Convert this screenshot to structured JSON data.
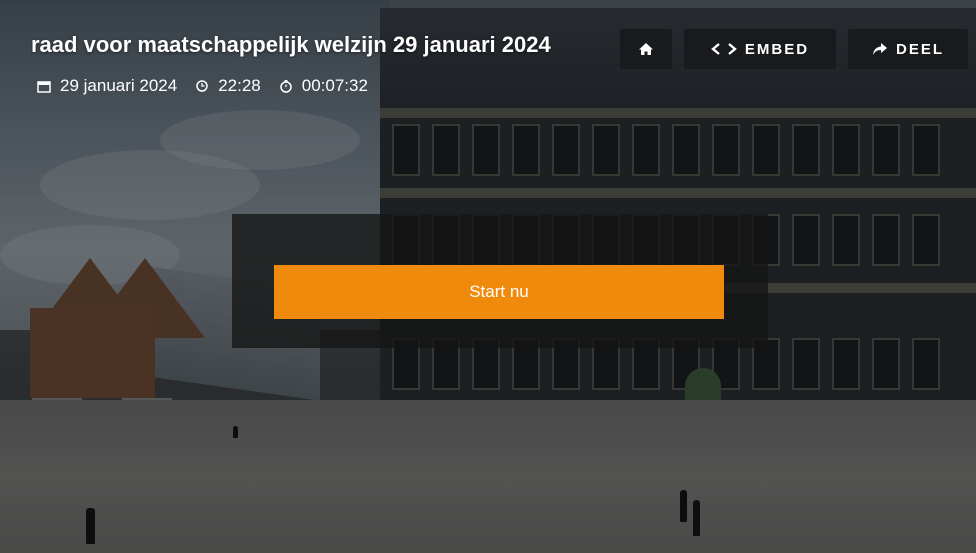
{
  "stream": {
    "title": "raad voor maatschappelijk welzijn 29 januari 2024",
    "date": "29 januari 2024",
    "time": "22:28",
    "duration": "00:07:32",
    "icons": {
      "date": "calendar-icon",
      "time": "clock-icon",
      "duration": "stopwatch-icon"
    }
  },
  "controls": {
    "home_icon": "home-icon",
    "embed_label": "EMBED",
    "embed_icon": "code-brackets-icon",
    "share_label": "DEEL",
    "share_icon": "share-arrow-icon"
  },
  "player": {
    "start_label": "Start nu",
    "accent_color": "#f08a0c"
  }
}
